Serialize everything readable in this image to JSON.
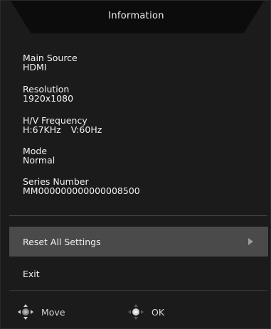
{
  "header": {
    "title": "Information"
  },
  "info": [
    {
      "label": "Main Source",
      "value": "HDMI"
    },
    {
      "label": "Resolution",
      "value": "1920x1080"
    },
    {
      "label": "H/V Frequency",
      "h_value": "H:67KHz",
      "v_value": "V:60Hz"
    },
    {
      "label": "Mode",
      "value": "Normal"
    },
    {
      "label": "Series Number",
      "value": "MM000000000000008500"
    }
  ],
  "menu": {
    "items": [
      {
        "label": "Reset All Settings",
        "selected": true,
        "icon": "arrow-right-icon"
      },
      {
        "label": "Exit",
        "selected": false
      }
    ]
  },
  "footer": {
    "move_label": "Move",
    "move_icon": "joystick-move-icon",
    "ok_label": "OK",
    "ok_icon": "joystick-press-icon"
  },
  "colors": {
    "background": "#1b1b1b",
    "title_tab": "#0c0c0c",
    "selected_row": "#4a4a4a",
    "text": "#f0f0f0",
    "icon_gray": "#9a9a9a"
  }
}
